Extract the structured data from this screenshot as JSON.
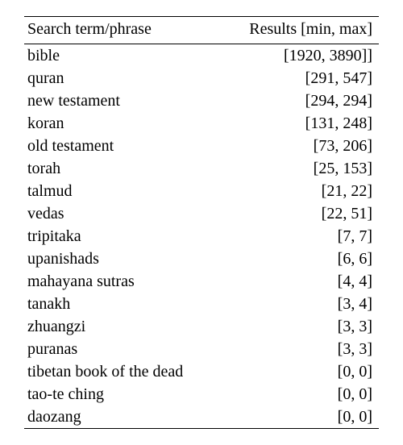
{
  "chart_data": {
    "type": "table",
    "columns": [
      "Search term/phrase",
      "Results [min, max]"
    ],
    "rows": [
      {
        "term": "bible",
        "range": "[1920, 3890]]"
      },
      {
        "term": "quran",
        "range": "[291, 547]"
      },
      {
        "term": "new testament",
        "range": "[294, 294]"
      },
      {
        "term": "koran",
        "range": "[131, 248]"
      },
      {
        "term": "old testament",
        "range": "[73, 206]"
      },
      {
        "term": "torah",
        "range": "[25, 153]"
      },
      {
        "term": "talmud",
        "range": "[21, 22]"
      },
      {
        "term": "vedas",
        "range": "[22, 51]"
      },
      {
        "term": "tripitaka",
        "range": "[7, 7]"
      },
      {
        "term": "upanishads",
        "range": "[6, 6]"
      },
      {
        "term": "mahayana sutras",
        "range": "[4, 4]"
      },
      {
        "term": "tanakh",
        "range": "[3, 4]"
      },
      {
        "term": "zhuangzi",
        "range": "[3, 3]"
      },
      {
        "term": "puranas",
        "range": "[3, 3]"
      },
      {
        "term": "tibetan book of the dead",
        "range": "[0, 0]"
      },
      {
        "term": "tao-te ching",
        "range": "[0, 0]"
      },
      {
        "term": "daozang",
        "range": "[0, 0]"
      }
    ]
  }
}
